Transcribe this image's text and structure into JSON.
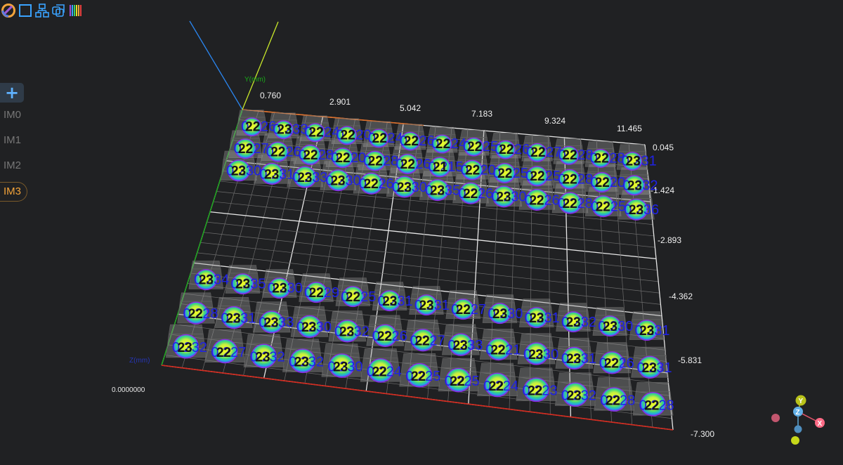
{
  "toolbar": {
    "icons": [
      "logo-icon",
      "square-icon",
      "hierarchy-icon",
      "layers-icon",
      "colorbar-icon"
    ]
  },
  "sidebar": {
    "add_label": "+",
    "items": [
      {
        "label": "IM0",
        "active": false
      },
      {
        "label": "IM1",
        "active": false
      },
      {
        "label": "IM2",
        "active": false
      },
      {
        "label": "IM3",
        "active": true
      }
    ]
  },
  "view": {
    "y_axis_label": "Y(mm)",
    "z_axis_label": "Z(mm)",
    "x_ticks": [
      "0.760",
      "2.901",
      "5.042",
      "7.183",
      "9.324",
      "11.465"
    ],
    "y_ticks": [
      "0.045",
      "-1.424",
      "-2.893",
      "-4.362",
      "-5.831",
      "-7.300"
    ],
    "overlap_text": "0.0000000",
    "colors": {
      "background": "#202123",
      "grid": "#d8d8d8",
      "axis_x": "#d62a1e",
      "axis_y": "#18a818",
      "label": "#1f22e6",
      "accent": "#f4a43a"
    }
  },
  "measurements": {
    "top_block": [
      [
        "0.226",
        "0.233",
        "0.224",
        "0.220",
        "0.224",
        "0.226",
        "0.224",
        "0.225",
        "0.226",
        "0.227",
        "0.228",
        "0.228",
        "0.231"
      ],
      [
        "0.227",
        "0.226",
        "0.228",
        "0.220",
        "0.228",
        "0.226",
        "0.215",
        "0.220",
        "0.225",
        "0.225",
        "0.228",
        "0.220",
        "0.232"
      ],
      [
        "0.230",
        "0.231",
        "0.233",
        "0.230",
        "0.226",
        "0.230",
        "0.235",
        "0.226",
        "0.230",
        "0.226",
        "0.228",
        "0.225",
        "0.236"
      ]
    ],
    "bottom_block": [
      [
        "0.234",
        "0.235",
        "0.230",
        "0.229",
        "0.225",
        "0.231",
        "0.231",
        "0.227",
        "0.230",
        "0.231",
        "0.232",
        "0.230",
        "0.231"
      ],
      [
        "0.228",
        "0.231",
        "0.233",
        "0.230",
        "0.232",
        "0.226",
        "0.227",
        "0.233",
        "0.221",
        "0.230",
        "0.231",
        "0.226",
        "0.231"
      ],
      [
        "0.232",
        "0.227",
        "0.232",
        "0.232",
        "0.230",
        "0.224",
        "0.225",
        "0.225",
        "0.224",
        "0.223",
        "0.232",
        "0.228",
        "0.228"
      ]
    ]
  },
  "orientation_gizmo": {
    "y": "Y",
    "z": "Z",
    "x": "X"
  }
}
